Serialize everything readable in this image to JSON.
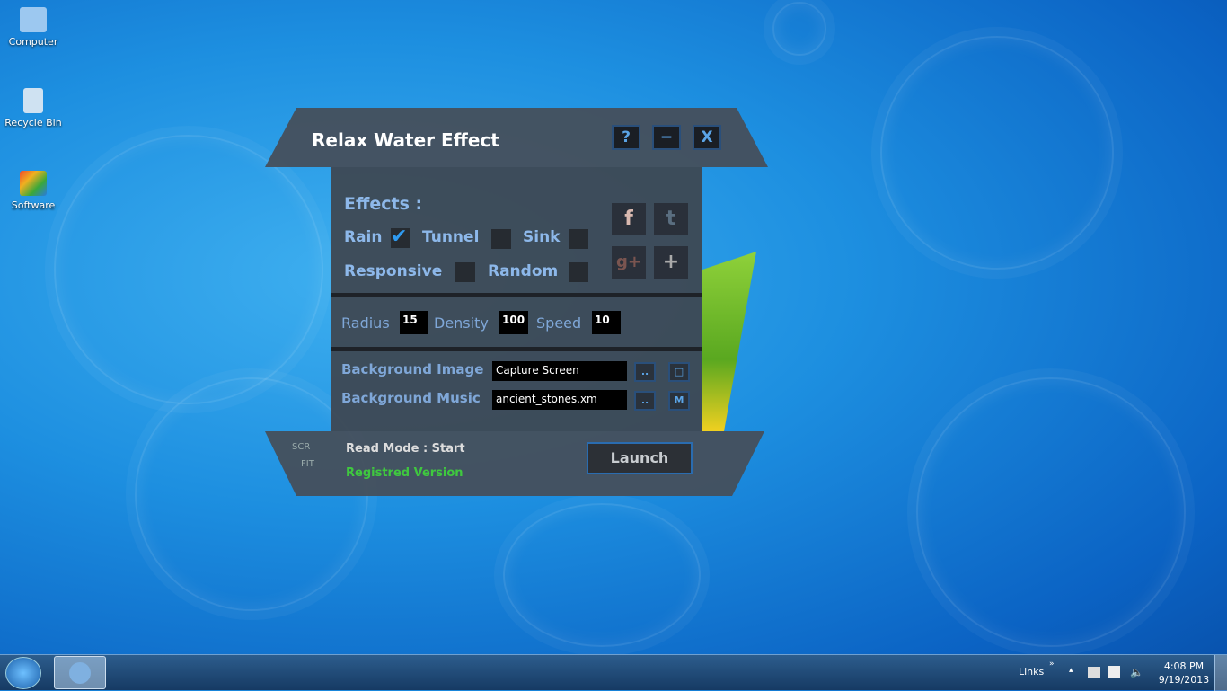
{
  "desktop": {
    "icons": [
      {
        "label": "Computer"
      },
      {
        "label": "Recycle Bin"
      },
      {
        "label": "Software"
      }
    ]
  },
  "window": {
    "title": "Relax Water Effect",
    "buttons": {
      "help": "?",
      "minimize": "−",
      "close": "X"
    },
    "effects": {
      "heading": "Effects :",
      "rain": "Rain",
      "tunnel": "Tunnel",
      "sink": "Sink",
      "responsive": "Responsive",
      "random": "Random",
      "check": "✔"
    },
    "social": {
      "facebook": "f",
      "twitter": "t",
      "google": "g+",
      "more": "+"
    },
    "params": {
      "radius_label": "Radius",
      "radius": "15",
      "density_label": "Density",
      "density": "100",
      "speed_label": "Speed",
      "speed": "10"
    },
    "background": {
      "image_label": "Background Image",
      "image_value": "Capture Screen",
      "music_label": "Background Music",
      "music_value": "ancient_stones.xm",
      "browse": "..",
      "image_btn": "□",
      "music_btn": "M"
    },
    "footer": {
      "scr": "SCR",
      "fit": "FIT",
      "read_mode": "Read Mode : Start",
      "version": "Registred Version",
      "launch": "Launch"
    }
  },
  "taskbar": {
    "links": "Links",
    "expand": "»",
    "time": "4:08 PM",
    "date": "9/19/2013"
  }
}
